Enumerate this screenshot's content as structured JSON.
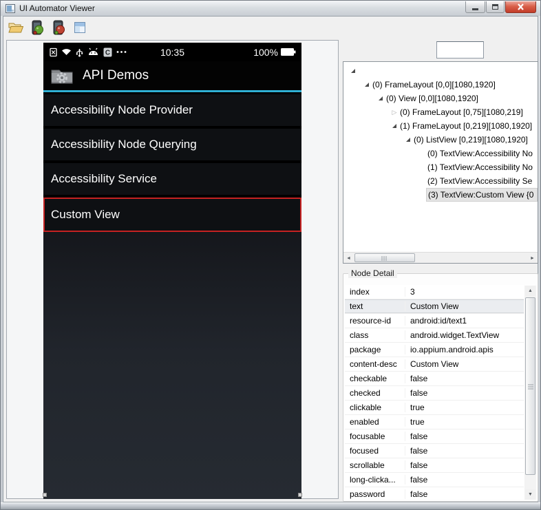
{
  "window": {
    "title": "UI Automator Viewer",
    "controls": [
      {
        "name": "minimize"
      },
      {
        "name": "maximize"
      },
      {
        "name": "close"
      }
    ]
  },
  "toolbar": {
    "icons": [
      "open-folder-icon",
      "device-screenshot-icon",
      "device-screenshot-compressed-icon",
      "save-screenshot-icon"
    ]
  },
  "device_screen": {
    "status_bar": {
      "time": "10:35",
      "battery_percent": "100%",
      "left_icons": [
        "no-sim-icon",
        "wifi-icon",
        "usb-icon",
        "android-icon",
        "app-c-icon",
        "more-notifications-icon"
      ],
      "right_icons": [
        "battery-icon"
      ]
    },
    "action_bar": {
      "title": "API Demos",
      "icon": "api-demos-folder-gear-icon"
    },
    "list_items": [
      {
        "label": "Accessibility Node Provider",
        "selected": false
      },
      {
        "label": "Accessibility Node Querying",
        "selected": false
      },
      {
        "label": "Accessibility Service",
        "selected": false
      },
      {
        "label": "Custom View",
        "selected": true
      }
    ]
  },
  "tree_panel": {
    "search_value": "",
    "nodes": [
      {
        "indent": 0,
        "expander": "expanded",
        "label": "",
        "selected": false
      },
      {
        "indent": 1,
        "expander": "expanded",
        "label": "(0) FrameLayout [0,0][1080,1920]",
        "selected": false
      },
      {
        "indent": 2,
        "expander": "expanded",
        "label": "(0) View [0,0][1080,1920]",
        "selected": false
      },
      {
        "indent": 3,
        "expander": "collapsed",
        "label": "(0) FrameLayout [0,75][1080,219]",
        "selected": false
      },
      {
        "indent": 3,
        "expander": "expanded",
        "label": "(1) FrameLayout [0,219][1080,1920]",
        "selected": false
      },
      {
        "indent": 4,
        "expander": "expanded",
        "label": "(0) ListView [0,219][1080,1920]",
        "selected": false
      },
      {
        "indent": 5,
        "expander": "none",
        "label": "(0) TextView:Accessibility No",
        "selected": false
      },
      {
        "indent": 5,
        "expander": "none",
        "label": "(1) TextView:Accessibility No",
        "selected": false
      },
      {
        "indent": 5,
        "expander": "none",
        "label": "(2) TextView:Accessibility Se",
        "selected": false
      },
      {
        "indent": 5,
        "expander": "none",
        "label": "(3) TextView:Custom View {0",
        "selected": true
      }
    ]
  },
  "node_detail": {
    "title": "Node Detail",
    "rows": [
      {
        "key": "index",
        "value": "3",
        "selected": false
      },
      {
        "key": "text",
        "value": "Custom View",
        "selected": true
      },
      {
        "key": "resource-id",
        "value": "android:id/text1",
        "selected": false
      },
      {
        "key": "class",
        "value": "android.widget.TextView",
        "selected": false
      },
      {
        "key": "package",
        "value": "io.appium.android.apis",
        "selected": false
      },
      {
        "key": "content-desc",
        "value": "Custom View",
        "selected": false
      },
      {
        "key": "checkable",
        "value": "false",
        "selected": false
      },
      {
        "key": "checked",
        "value": "false",
        "selected": false
      },
      {
        "key": "clickable",
        "value": "true",
        "selected": false
      },
      {
        "key": "enabled",
        "value": "true",
        "selected": false
      },
      {
        "key": "focusable",
        "value": "false",
        "selected": false
      },
      {
        "key": "focused",
        "value": "false",
        "selected": false
      },
      {
        "key": "scrollable",
        "value": "false",
        "selected": false
      },
      {
        "key": "long-clicka...",
        "value": "false",
        "selected": false
      },
      {
        "key": "password",
        "value": "false",
        "selected": false
      }
    ]
  },
  "colors": {
    "accent_cyan": "#2fb0d4",
    "selection_red": "#c62222",
    "close_button_red": "#c23c28",
    "phone_background": "#0e1013"
  }
}
